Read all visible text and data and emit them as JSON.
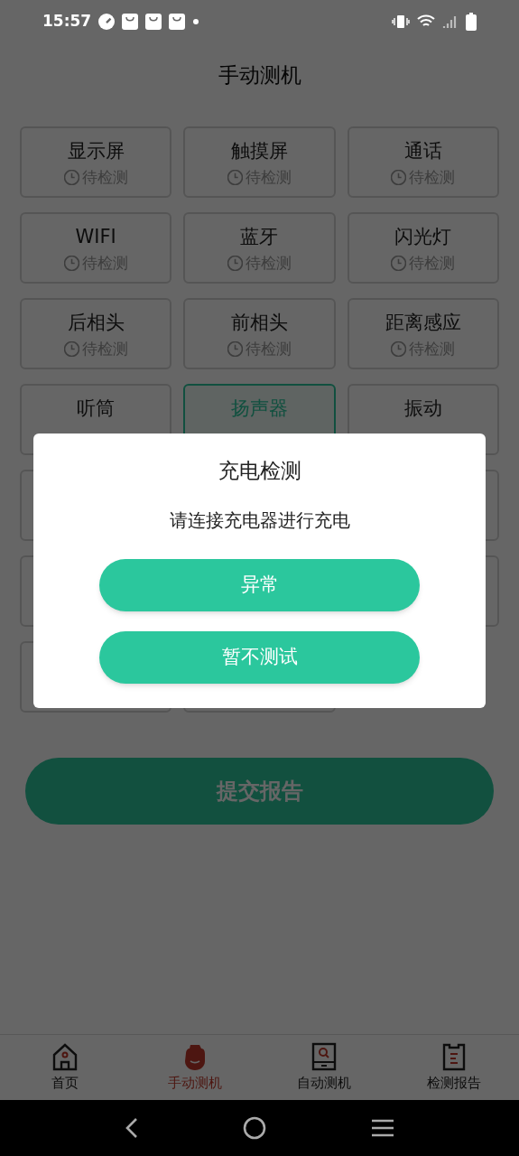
{
  "status_bar": {
    "time": "15:57"
  },
  "title": "手动测机",
  "tests": [
    {
      "name": "显示屏",
      "status": "待检测",
      "selected": false
    },
    {
      "name": "触摸屏",
      "status": "待检测",
      "selected": false
    },
    {
      "name": "通话",
      "status": "待检测",
      "selected": false
    },
    {
      "name": "WIFI",
      "status": "待检测",
      "selected": false
    },
    {
      "name": "蓝牙",
      "status": "待检测",
      "selected": false
    },
    {
      "name": "闪光灯",
      "status": "待检测",
      "selected": false
    },
    {
      "name": "后相头",
      "status": "待检测",
      "selected": false
    },
    {
      "name": "前相头",
      "status": "待检测",
      "selected": false
    },
    {
      "name": "距离感应",
      "status": "待检测",
      "selected": false
    },
    {
      "name": "听筒",
      "selected": false
    },
    {
      "name": "扬声器",
      "selected": true
    },
    {
      "name": "振动",
      "selected": false
    }
  ],
  "submit_button": "提交报告",
  "dialog": {
    "title": "充电检测",
    "message": "请连接充电器进行充电",
    "buttons": [
      "异常",
      "暂不测试"
    ]
  },
  "bottom_nav": [
    {
      "label": "首页",
      "kind": "home",
      "selected": false
    },
    {
      "label": "手动测机",
      "kind": "manual",
      "selected": true
    },
    {
      "label": "自动测机",
      "kind": "auto",
      "selected": false
    },
    {
      "label": "检测报告",
      "kind": "report",
      "selected": false
    }
  ]
}
